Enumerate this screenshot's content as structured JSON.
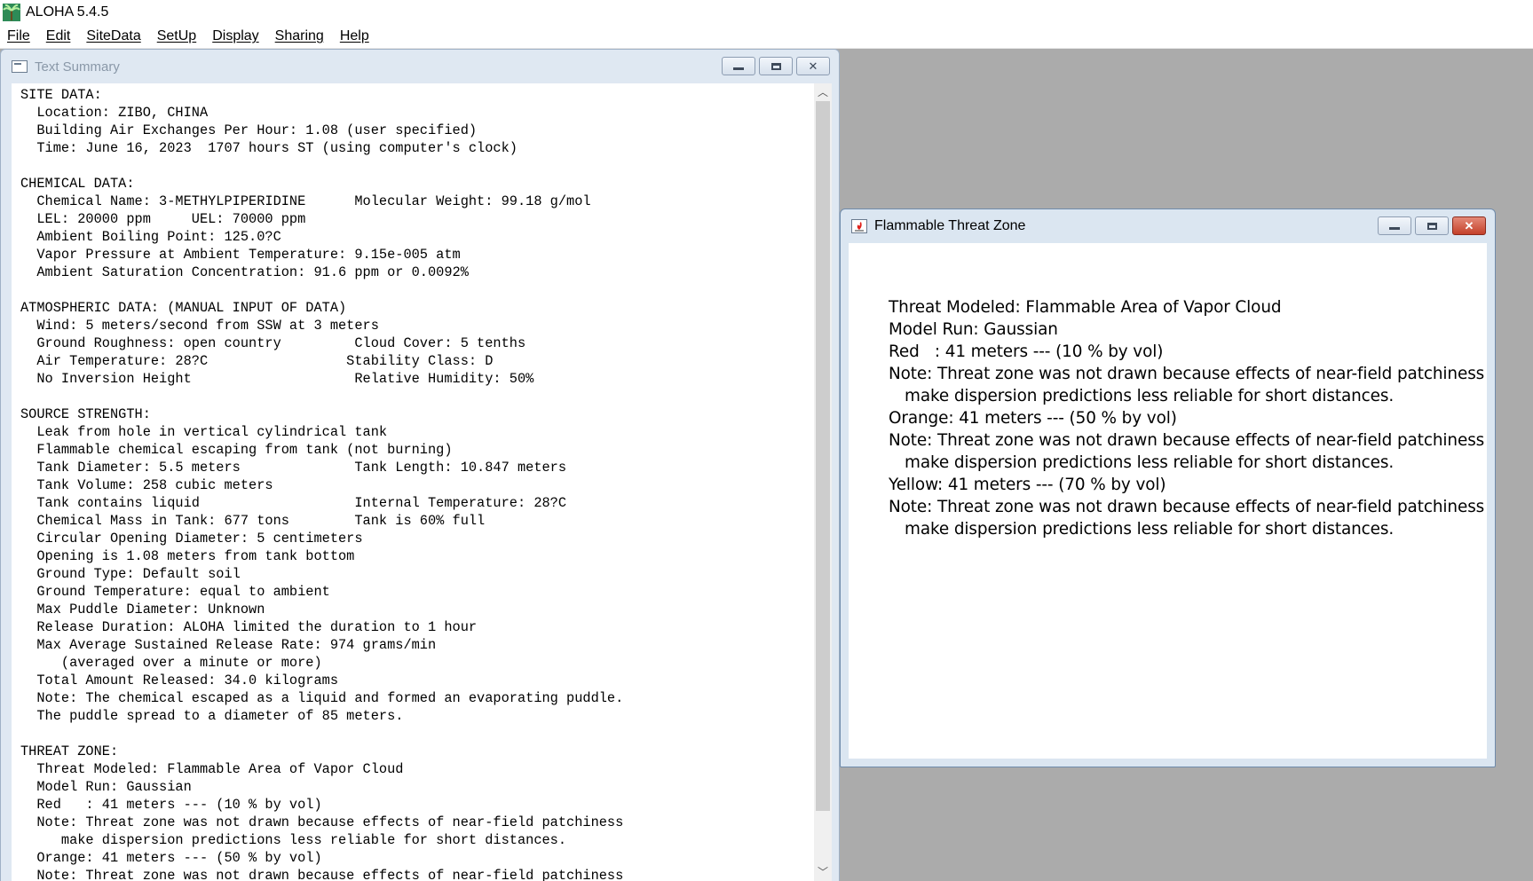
{
  "app": {
    "title": "ALOHA 5.4.5",
    "menu": [
      "File",
      "Edit",
      "SiteData",
      "SetUp",
      "Display",
      "Sharing",
      "Help"
    ]
  },
  "text_summary": {
    "title": "Text Summary",
    "lines": [
      "SITE DATA:",
      "  Location: ZIBO, CHINA",
      "  Building Air Exchanges Per Hour: 1.08 (user specified)",
      "  Time: June 16, 2023  1707 hours ST (using computer's clock)",
      "",
      "CHEMICAL DATA:",
      "  Chemical Name: 3-METHYLPIPERIDINE      Molecular Weight: 99.18 g/mol",
      "  LEL: 20000 ppm     UEL: 70000 ppm",
      "  Ambient Boiling Point: 125.0?C",
      "  Vapor Pressure at Ambient Temperature: 9.15e-005 atm",
      "  Ambient Saturation Concentration: 91.6 ppm or 0.0092%",
      "",
      "ATMOSPHERIC DATA: (MANUAL INPUT OF DATA)",
      "  Wind: 5 meters/second from SSW at 3 meters",
      "  Ground Roughness: open country         Cloud Cover: 5 tenths",
      "  Air Temperature: 28?C                 Stability Class: D",
      "  No Inversion Height                    Relative Humidity: 50%",
      "",
      "SOURCE STRENGTH:",
      "  Leak from hole in vertical cylindrical tank",
      "  Flammable chemical escaping from tank (not burning)",
      "  Tank Diameter: 5.5 meters              Tank Length: 10.847 meters",
      "  Tank Volume: 258 cubic meters",
      "  Tank contains liquid                   Internal Temperature: 28?C",
      "  Chemical Mass in Tank: 677 tons        Tank is 60% full",
      "  Circular Opening Diameter: 5 centimeters",
      "  Opening is 1.08 meters from tank bottom",
      "  Ground Type: Default soil",
      "  Ground Temperature: equal to ambient",
      "  Max Puddle Diameter: Unknown",
      "  Release Duration: ALOHA limited the duration to 1 hour",
      "  Max Average Sustained Release Rate: 974 grams/min",
      "     (averaged over a minute or more)",
      "  Total Amount Released: 34.0 kilograms",
      "  Note: The chemical escaped as a liquid and formed an evaporating puddle.",
      "  The puddle spread to a diameter of 85 meters.",
      "",
      "THREAT ZONE:",
      "  Threat Modeled: Flammable Area of Vapor Cloud",
      "  Model Run: Gaussian",
      "  Red   : 41 meters --- (10 % by vol)",
      "  Note: Threat zone was not drawn because effects of near-field patchiness",
      "     make dispersion predictions less reliable for short distances.",
      "  Orange: 41 meters --- (50 % by vol)",
      "  Note: Threat zone was not drawn because effects of near-field patchiness"
    ]
  },
  "threat_zone": {
    "title": "Flammable Threat Zone",
    "threat_modeled": "Threat Modeled: Flammable Area of Vapor Cloud",
    "model_run": "Model Run: Gaussian",
    "red": "Red   : 41 meters --- (10 % by vol)",
    "note1a": "Note: Threat zone was not drawn because effects of near-field patchiness",
    "note1b": "make dispersion predictions less reliable for short distances.",
    "orange": "Orange: 41 meters --- (50 % by vol)",
    "note2a": "Note: Threat zone was not drawn because effects of near-field patchiness",
    "note2b": "make dispersion predictions less reliable for short distances.",
    "yellow": "Yellow: 41 meters --- (70 % by vol)",
    "note3a": "Note: Threat zone was not drawn because effects of near-field patchiness",
    "note3b": "make dispersion predictions less reliable for short distances."
  },
  "colors": {
    "desktop": "#ababab",
    "close_button_active": "#c4402a"
  }
}
